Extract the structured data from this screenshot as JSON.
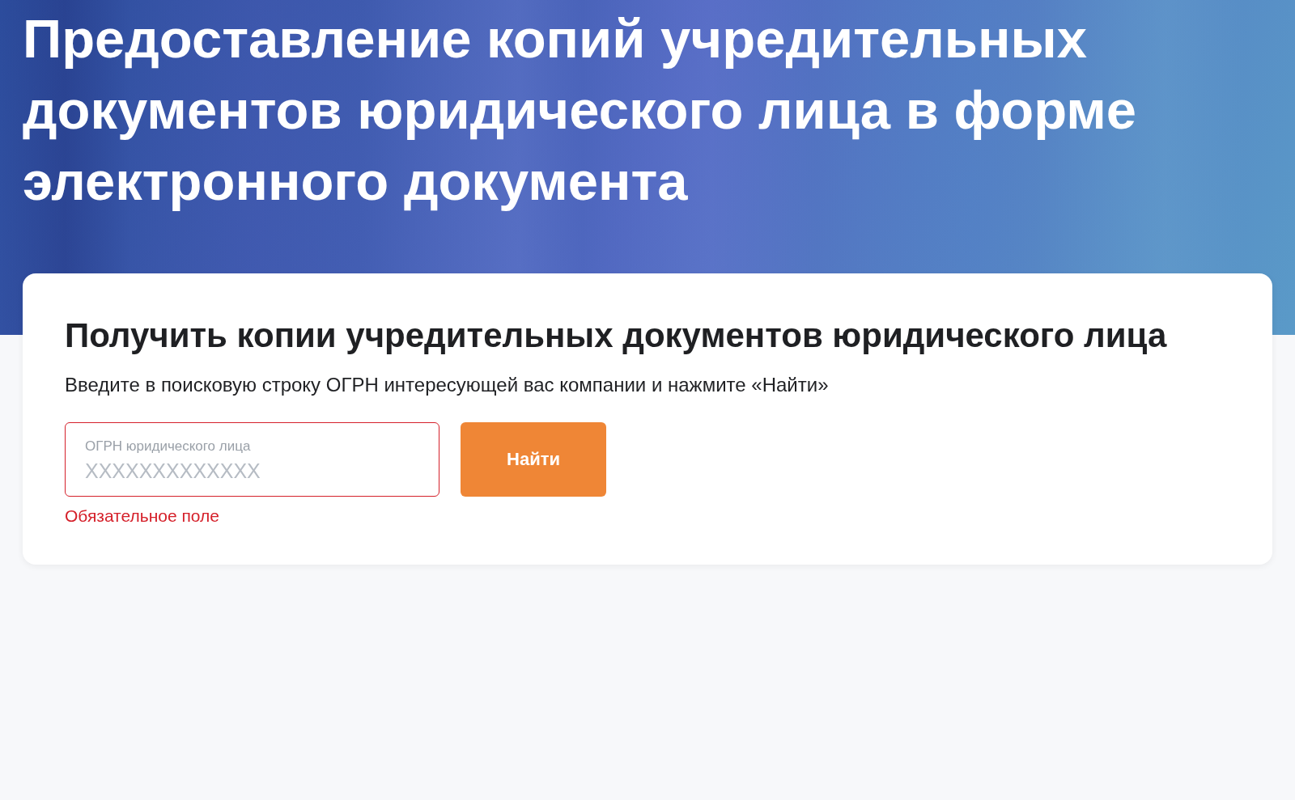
{
  "hero": {
    "title": "Предоставление копий учредительных документов юридического лица в форме электронного документа"
  },
  "card": {
    "heading": "Получить копии учредительных документов юридического лица",
    "hint": "Введите в поисковую строку ОГРН интересующей вас компании и нажмите «Найти»",
    "field": {
      "label": "ОГРН юридического лица",
      "placeholder": "XXXXXXXXXXXXX",
      "invalid": true,
      "error": "Обязательное поле"
    },
    "button": "Найти"
  }
}
